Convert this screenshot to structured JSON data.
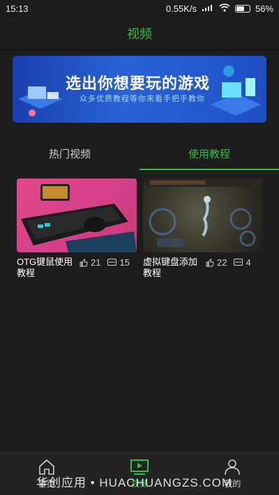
{
  "status": {
    "time": "15:13",
    "speed": "0.55K/s",
    "battery": "56%"
  },
  "header": {
    "title": "视频"
  },
  "banner": {
    "title": "选出你想要玩的游戏",
    "subtitle": "众多优质教程等你来看手把手教你"
  },
  "tabs": [
    {
      "label": "热门视频",
      "active": false
    },
    {
      "label": "使用教程",
      "active": true
    }
  ],
  "videos": [
    {
      "title": "OTG键鼠使用教程",
      "likes": "21",
      "comments": "15"
    },
    {
      "title": "虚拟键盘添加教程",
      "likes": "22",
      "comments": "4"
    }
  ],
  "nav": [
    {
      "label": "首页"
    },
    {
      "label": "视频"
    },
    {
      "label": "我的"
    }
  ],
  "watermark": "华创应用 • HUACHUANGZS.COM",
  "colors": {
    "accent": "#2fbf4a",
    "background": "#1c1c1c"
  }
}
